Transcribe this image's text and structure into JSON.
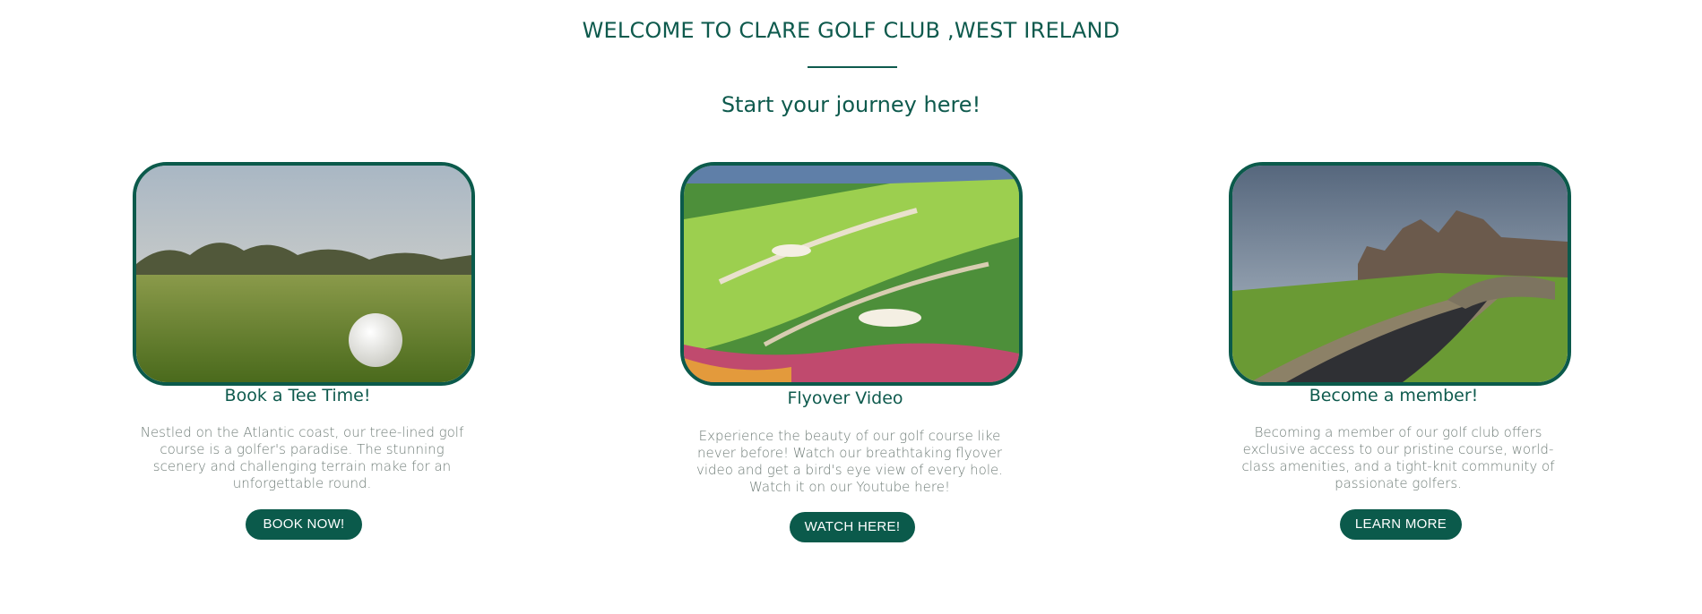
{
  "header": {
    "welcome": "WELCOME TO CLARE GOLF CLUB ,WEST IRELAND",
    "tagline": "Start your journey here!"
  },
  "cards": [
    {
      "title": "Book a Tee Time!",
      "text": "Nestled on the Atlantic coast, our tree-lined golf course is a golfer's paradise. The stunning scenery and challenging terrain make for an unforgettable round.",
      "button": "BOOK NOW!",
      "image": "golf-ball-on-fairway"
    },
    {
      "title": "Flyover Video",
      "text": "Experience the beauty of our golf course like never before! Watch our breathtaking flyover video and get a bird's eye view of every hole. Watch it on our Youtube here!",
      "button": "WATCH HERE!",
      "image": "aerial-golf-course"
    },
    {
      "title": "Become a member!",
      "text": "Becoming a member of our golf club offers exclusive access to our pristine course, world-class amenities, and a tight-knit community of passionate golfers.",
      "button": "LEARN MORE",
      "image": "clubhouse-and-bridge"
    }
  ],
  "colors": {
    "brand_green": "#0b5a4b",
    "body_text": "#707d78"
  }
}
